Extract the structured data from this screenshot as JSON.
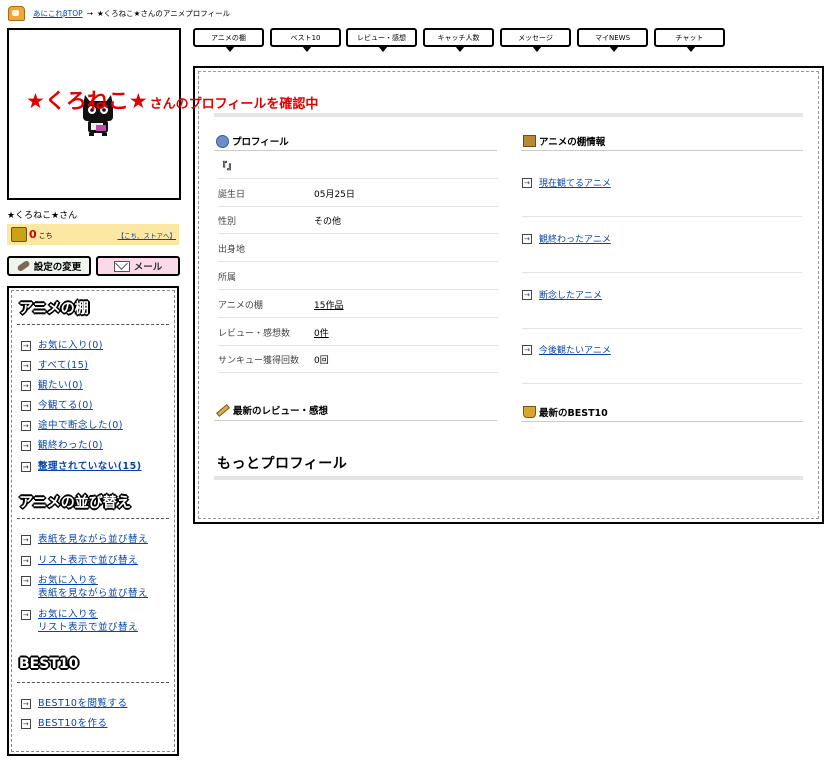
{
  "breadcrumb": {
    "home": "あにこれβTOP",
    "sep": "→",
    "current": "★くろねこ★さんのアニメプロフィール"
  },
  "user": {
    "display_name": "★くろねこ★さん",
    "coins": "0",
    "coin_unit": "こち",
    "coin_link": "【こち、ストアへ】"
  },
  "buttons": {
    "settings": "設定の変更",
    "mail": "メール"
  },
  "tabs": [
    "アニメの棚",
    "ベスト10",
    "レビュー・感想",
    "キャッチ人数",
    "メッセージ",
    "マイNEWS",
    "チャット"
  ],
  "sidebar": {
    "sections": [
      {
        "title": "アニメの棚",
        "items": [
          "お気に入り(0)",
          "すべて(15)",
          "観たい(0)",
          "今観てる(0)",
          "途中で断念した(0)",
          "観終わった(0)",
          "整理されていない(15)"
        ]
      },
      {
        "title": "アニメの並び替え",
        "items": [
          "表紙を見ながら並び替え",
          "リスト表示で並び替え",
          "お気に入りを",
          "表紙を見ながら並び替え",
          "お気に入りを",
          "リスト表示で並び替え"
        ]
      },
      {
        "title": "BEST10",
        "items": [
          "BEST10を閲覧する",
          "BEST10を作る"
        ]
      }
    ]
  },
  "main": {
    "title_name": "★くろねこ★",
    "title_suffix": "さんのプロフィールを確認中",
    "profile": {
      "heading": "プロフィール",
      "quote": "『』",
      "rows": [
        {
          "label": "誕生日",
          "value": "05月25日"
        },
        {
          "label": "性別",
          "value": "その他"
        },
        {
          "label": "出身地",
          "value": ""
        },
        {
          "label": "所属",
          "value": ""
        },
        {
          "label": "アニメの棚",
          "value": "15作品"
        },
        {
          "label": "レビュー・感想数",
          "value": "0件"
        },
        {
          "label": "サンキュー獲得回数",
          "value": "0回"
        }
      ]
    },
    "shelf": {
      "heading": "アニメの棚情報",
      "items": [
        "現在観てるアニメ",
        "観終わったアニメ",
        "断念したアニメ",
        "今後観たいアニメ"
      ]
    },
    "reviews": {
      "heading": "最新のレビュー・感想"
    },
    "best10": {
      "heading": "最新のBEST10"
    },
    "more": "もっとプロフィール"
  },
  "icons": [
    "home-icon",
    "coin-icon",
    "wrench-icon",
    "mail-icon",
    "arrow-right-icon",
    "person-icon",
    "book-icon",
    "pen-icon",
    "trophy-icon"
  ],
  "colors": {
    "title_red": "#e00000",
    "coin_bg": "#fde8a3",
    "link_blue": "#0645ad",
    "mail_pink": "#fbd8ea"
  }
}
